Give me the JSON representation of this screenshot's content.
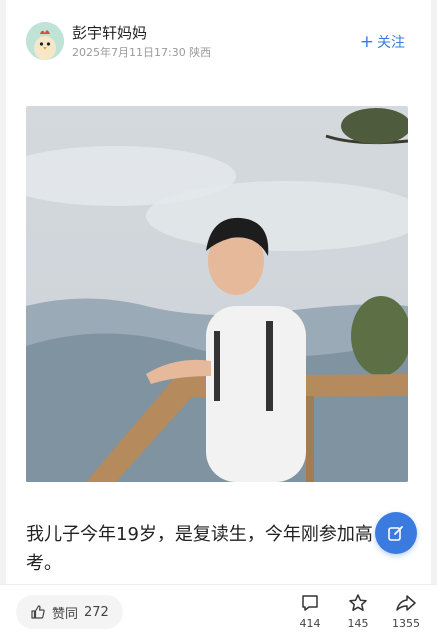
{
  "header": {
    "author_name": "彭宇轩妈妈",
    "meta": "2025年7月11日17:30 陕西",
    "follow_label": "关注",
    "follow_icon": "plus-icon"
  },
  "post": {
    "text": "我儿子今年19岁，是复读生，今年刚参加高考。"
  },
  "actions": {
    "like_label": "赞同",
    "like_count": "272",
    "comment_count": "414",
    "favorite_count": "145",
    "share_count": "1355"
  },
  "colors": {
    "accent": "#3b7be0"
  }
}
